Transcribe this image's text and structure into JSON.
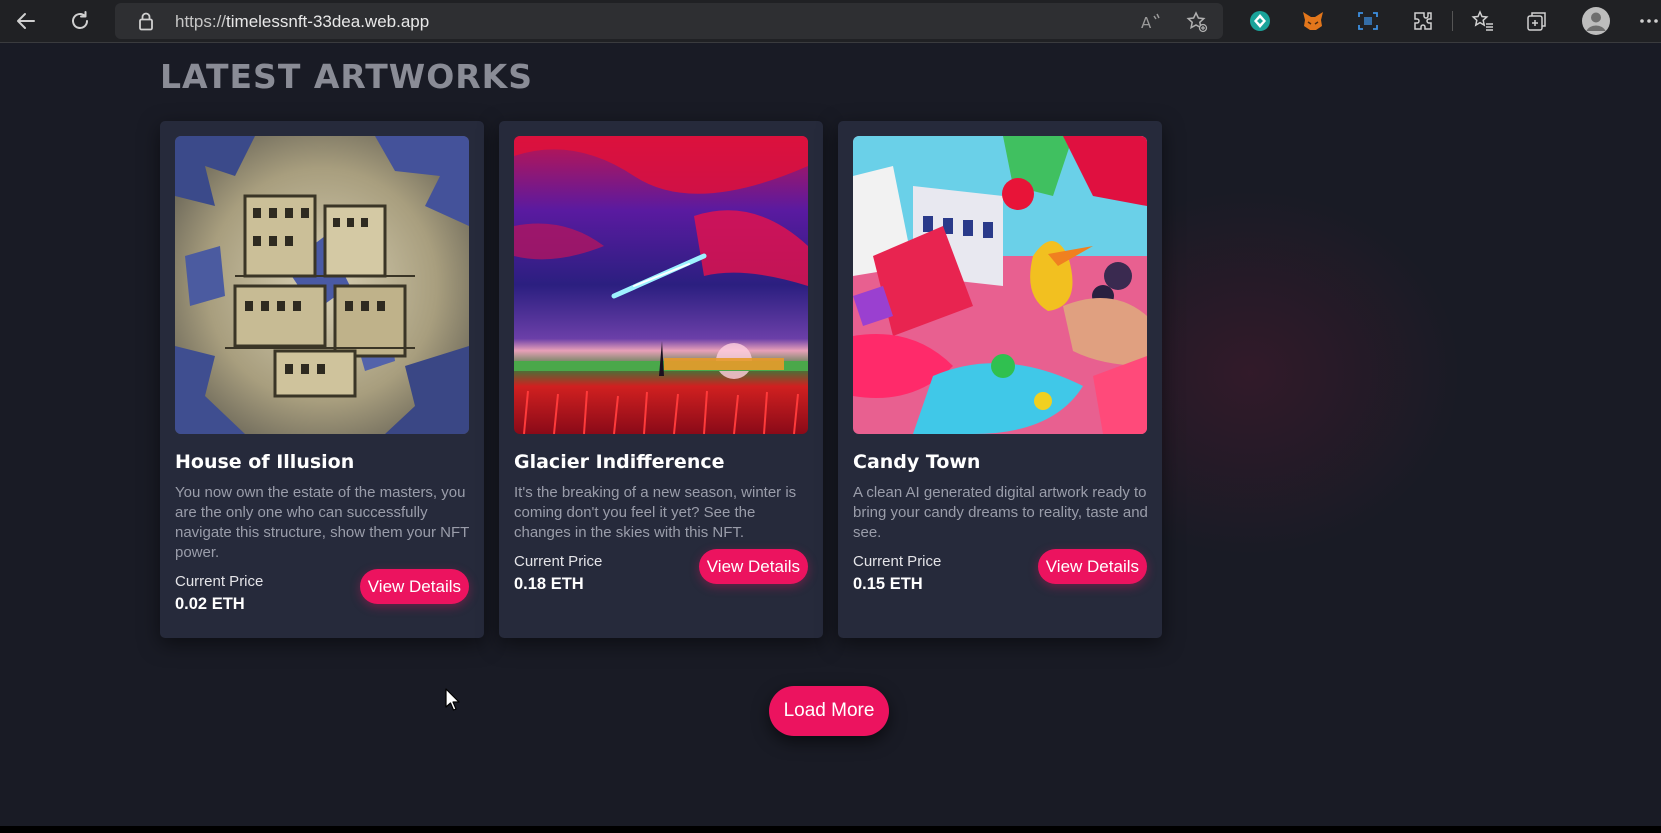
{
  "browser": {
    "url_prefix": "https://",
    "url_host": "timelessnft-33dea.web.app",
    "icons": [
      "back-arrow-icon",
      "refresh-icon",
      "lock-icon",
      "read-aloud-icon",
      "add-favorite-icon",
      "extension-green-icon",
      "metamask-icon",
      "screen-capture-icon",
      "extensions-icon",
      "favorites-icon",
      "collections-icon",
      "profile-icon",
      "more-icon"
    ]
  },
  "section": {
    "title": "LATEST ARTWORKS"
  },
  "cards": [
    {
      "title": "House of Illusion",
      "description": "You now own the estate of the masters, you are the only one who can successfully navigate this structure, show them your NFT power.",
      "price_label": "Current Price",
      "price": "0.02 ETH",
      "button": "View Details"
    },
    {
      "title": "Glacier Indifference",
      "description": "It's the breaking of a new season, winter is coming don't you feel it yet? See the changes in the skies with this NFT.",
      "price_label": "Current Price",
      "price": "0.18 ETH",
      "button": "View Details"
    },
    {
      "title": "Candy Town",
      "description": "A clean AI generated digital artwork ready to bring your candy dreams to reality, taste and see.",
      "price_label": "Current Price",
      "price": "0.15 ETH",
      "button": "View Details"
    }
  ],
  "load_more": "Load More",
  "colors": {
    "accent": "#ec135f",
    "page_bg": "#191b25",
    "card_bg": "#262a3b"
  }
}
